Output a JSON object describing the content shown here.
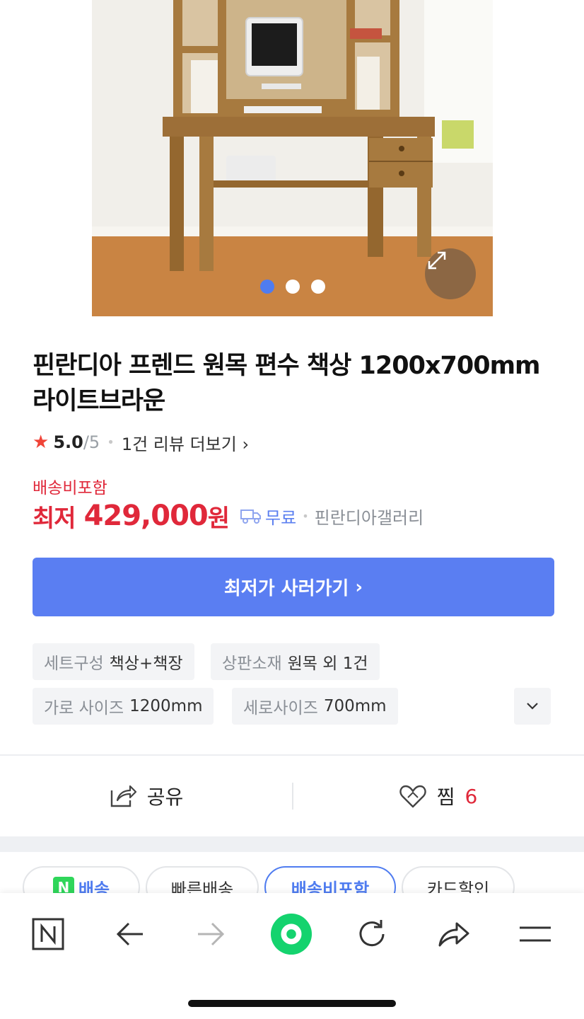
{
  "product": {
    "title": "핀란디아 프렌드 원목 편수 책상 1200x700mm 라이트브라운",
    "rating": {
      "score": "5.0",
      "outof": "/5",
      "reviews": "1건 리뷰 더보기"
    },
    "shipping_note": "배송비포함",
    "price": {
      "prefix": "최저",
      "value": "429,000",
      "unit": "원"
    },
    "free_shipping": "무료",
    "seller": "핀란디아갤러리",
    "buy_button": "최저가 사러가기"
  },
  "gallery": {
    "count": 3,
    "active_index": 0
  },
  "specs": [
    {
      "key": "세트구성",
      "value": "책상+책장"
    },
    {
      "key": "상판소재",
      "value": "원목 외 1건"
    },
    {
      "key": "가로 사이즈",
      "value": "1200mm"
    },
    {
      "key": "세로사이즈",
      "value": "700mm"
    }
  ],
  "actions": {
    "share_label": "공유",
    "wish_label": "찜",
    "wish_count": "6"
  },
  "filters": [
    {
      "label": "배송",
      "badge": "N"
    },
    {
      "label": "빠른배송"
    },
    {
      "label": "배송비포함",
      "active": true
    },
    {
      "label": "카드할인"
    }
  ],
  "colors": {
    "accent": "#5a7ef2",
    "price": "#e0283a",
    "naver_green": "#03c75a"
  },
  "bottom_bar_icons": [
    "naver-n-icon",
    "back-arrow-icon",
    "forward-arrow-icon",
    "green-home-icon",
    "refresh-icon",
    "share-icon",
    "menu-icon"
  ]
}
